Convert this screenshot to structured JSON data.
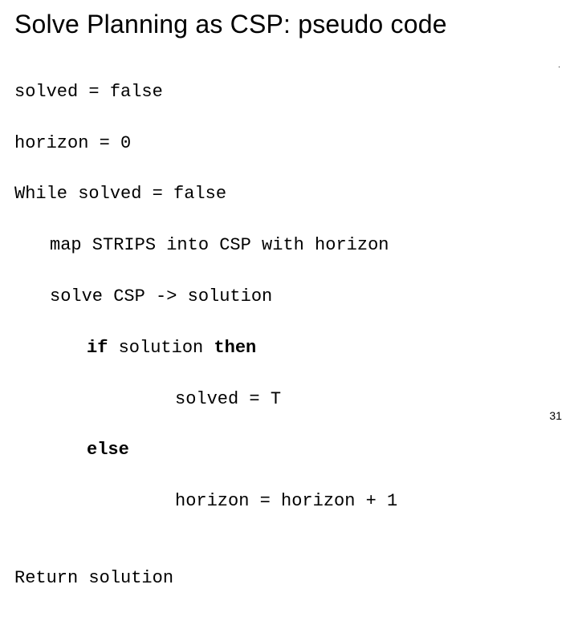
{
  "title": "Solve Planning as CSP: pseudo code",
  "code": {
    "l1": "solved = false",
    "l2": "horizon = 0",
    "l3": "While solved = false",
    "l4": "map STRIPS into CSP with horizon",
    "l5": "solve CSP -> solution",
    "l6a": "if",
    "l6b": " solution ",
    "l6c": "then",
    "l7": "solved = T",
    "l8": "else",
    "l9": "horizon = horizon + 1",
    "l10": "Return solution"
  },
  "page_number": "31",
  "dot": "."
}
